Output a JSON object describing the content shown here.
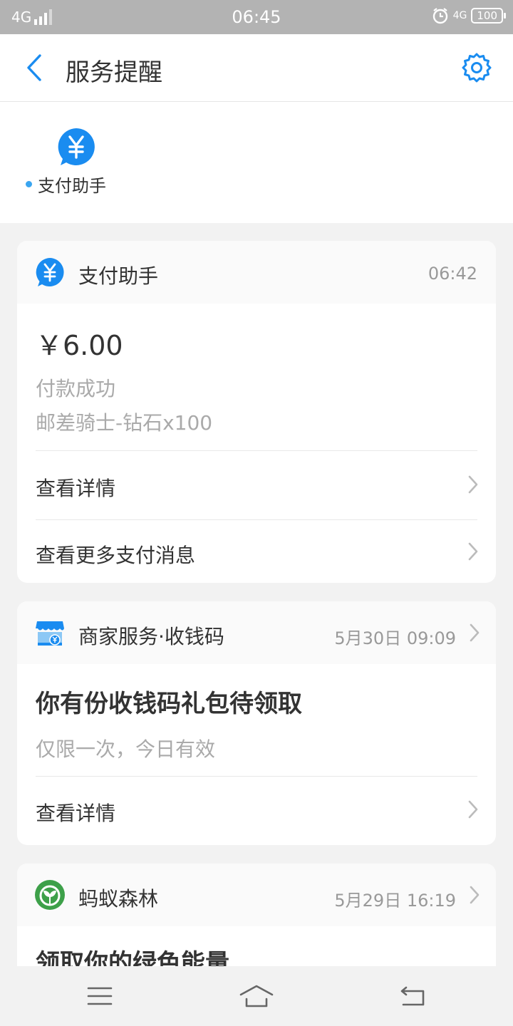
{
  "status_bar": {
    "network": "4G",
    "time": "06:45",
    "right_network": "4G",
    "battery": "100"
  },
  "header": {
    "title": "服务提醒"
  },
  "service_strip": {
    "items": [
      {
        "label": "支付助手",
        "icon": "yuan-icon",
        "unread": true
      }
    ]
  },
  "cards": [
    {
      "source": "支付助手",
      "time": "06:42",
      "icon": "yuan-icon",
      "amount": "￥6.00",
      "status": "付款成功",
      "description": "邮差骑士-钻石x100",
      "links": [
        "查看详情",
        "查看更多支付消息"
      ]
    },
    {
      "source": "商家服务·收钱码",
      "time": "5月30日 09:09",
      "icon": "merchant-store-icon",
      "title": "你有份收钱码礼包待领取",
      "subtitle": "仅限一次，今日有效",
      "links": [
        "查看详情"
      ]
    },
    {
      "source": "蚂蚁森林",
      "time": "5月29日 16:19",
      "icon": "ant-forest-icon",
      "title": "领取你的绿色能量"
    }
  ],
  "colors": {
    "accent": "#1a8cf0",
    "status_bar": "#b3b3b3",
    "dot": "#3aa5f0",
    "forest_green": "#3da049"
  }
}
